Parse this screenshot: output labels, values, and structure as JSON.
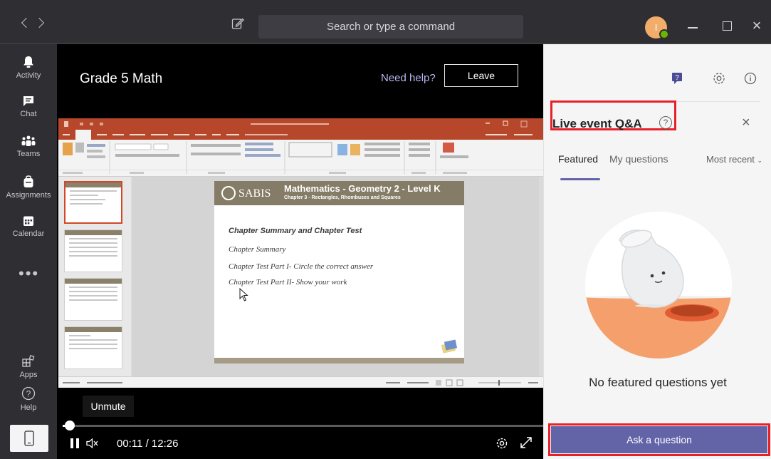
{
  "titlebar": {
    "search_placeholder": "Search or type a command",
    "avatar_initial": "I"
  },
  "rail": {
    "items": [
      {
        "label": "Activity",
        "icon": "bell-icon"
      },
      {
        "label": "Chat",
        "icon": "chat-icon"
      },
      {
        "label": "Teams",
        "icon": "teams-icon"
      },
      {
        "label": "Assignments",
        "icon": "backpack-icon"
      },
      {
        "label": "Calendar",
        "icon": "calendar-icon"
      }
    ],
    "more": "•••",
    "bottom": [
      {
        "label": "Apps",
        "icon": "apps-icon"
      },
      {
        "label": "Help",
        "icon": "help-icon"
      }
    ]
  },
  "event": {
    "title": "Grade 5 Math",
    "need_help": "Need help?",
    "leave": "Leave"
  },
  "slide": {
    "brand": "SABIS",
    "heading": "Mathematics - Geometry 2 - Level K",
    "subheading": "Chapter 3 - Rectangles, Rhombuses and Squares",
    "lines": [
      "Chapter Summary and Chapter Test",
      "Chapter Summary",
      "Chapter Test Part I- Circle the correct answer",
      "Chapter Test Part II- Show your work"
    ]
  },
  "player": {
    "unmute": "Unmute",
    "time": "00:11 / 12:26",
    "progress": 0.015
  },
  "panel": {
    "title": "Live event Q&A",
    "tabs": [
      "Featured",
      "My questions"
    ],
    "sort": "Most recent",
    "empty": "No featured questions yet",
    "ask": "Ask a question"
  },
  "colors": {
    "accent": "#6264a7",
    "highlight": "#e8202a",
    "rail": "#2f2f33"
  }
}
